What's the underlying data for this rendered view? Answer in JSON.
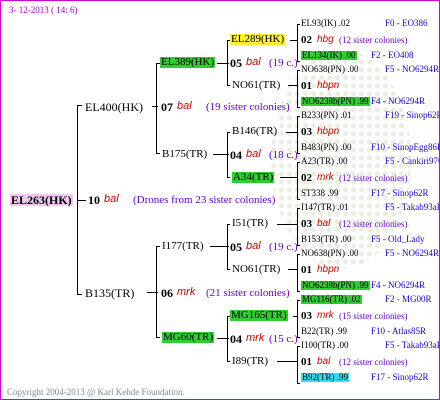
{
  "header": {
    "date_line": "3- 12-2013 ( 14: 6)"
  },
  "root": {
    "name": "EL263(HK)",
    "year": "10",
    "code": "bal",
    "sisters": "(Drones from 23 sister colonies)"
  },
  "gen1": [
    {
      "name": "EL400(HK)",
      "year": "07",
      "code": "bal",
      "sisters": "(19 sister colonies)"
    },
    {
      "name": "B135(TR)",
      "year": "06",
      "code": "mrk",
      "sisters": "(21 sister colonies)"
    }
  ],
  "gen2": [
    {
      "name": "EL389(HK)",
      "year": "05",
      "code": "bal",
      "sisters": "(19 c.)"
    },
    {
      "name": "B175(TR)",
      "year": "04",
      "code": "bal",
      "sisters": "(18 c.)"
    },
    {
      "name": "I177(TR)",
      "year": "05",
      "code": "bal",
      "sisters": "(19 c.)"
    },
    {
      "name": "MG60(TR)",
      "year": "04",
      "code": "mrk",
      "sisters": "(15 c.)"
    }
  ],
  "gen3": [
    {
      "name": "EL289(HK)"
    },
    {
      "name": "NO61(TR)"
    },
    {
      "name": "B146(TR)"
    },
    {
      "name": "A34(TR)"
    },
    {
      "name": "I51(TR)"
    },
    {
      "name": "NO61(TR)"
    },
    {
      "name": "MG165(TR)"
    },
    {
      "name": "I89(TR)"
    }
  ],
  "gen4": [
    {
      "top": "EL93(IK) .02",
      "top_r": "F0 - EO386",
      "mid_y": "02",
      "mid_c": "hbg",
      "mid_s": "(12 sister colonies)",
      "bot": "EL134(IK) .00",
      "bot_r": "F2 - EO408"
    },
    {
      "top": "NO638(PN) .00",
      "top_r": "F5 - NO6294R",
      "mid_y": "01",
      "mid_c": "hbpn",
      "mid_s": "",
      "bot": "NO6238b(PN) .99",
      "bot_r": "F4 - NO6294R"
    },
    {
      "top": "B233(PN) .01",
      "top_r": "F19 - Sinop62R",
      "mid_y": "03",
      "mid_c": "hbpn",
      "mid_s": "",
      "bot": "B483(PN) .00",
      "bot_r": "F10 - SinopEgg86R"
    },
    {
      "top": "A23(TR) .00",
      "top_r": "F5 - Cankiri97Q",
      "mid_y": "02",
      "mid_c": "mrk",
      "mid_s": "(12 sister colonies)",
      "bot": "ST338 .99",
      "bot_r": "F17 - Sinop62R"
    },
    {
      "top": "I147(TR) .01",
      "top_r": "F5 - Takab93aR",
      "mid_y": "03",
      "mid_c": "bal",
      "mid_s": "(12 sister colonies)",
      "bot": "B153(TR) .00",
      "bot_r": "F5 - Old_Lady"
    },
    {
      "top": "NO638(PN) .00",
      "top_r": "F5 - NO6294R",
      "mid_y": "01",
      "mid_c": "hbpn",
      "mid_s": "",
      "bot": "NO6238b(PN) .99",
      "bot_r": "F4 - NO6294R"
    },
    {
      "top": "MG116(TR) .02",
      "top_r": "F2 - MG00R",
      "mid_y": "03",
      "mid_c": "mrk",
      "mid_s": "(15 sister colonies)",
      "bot": "B22(TR) .99",
      "bot_r": "F10 - Atlas85R"
    },
    {
      "top": "I100(TR) .00",
      "top_r": "F5 - Takab93aR",
      "mid_y": "01",
      "mid_c": "bal",
      "mid_s": "(12 sister colonies)",
      "bot": "B92(TR) .99",
      "bot_r": "F17 - Sinop62R"
    }
  ],
  "footer": {
    "copyright": "Copyright 2004-2013 @ Karl Kehde Foundation."
  }
}
